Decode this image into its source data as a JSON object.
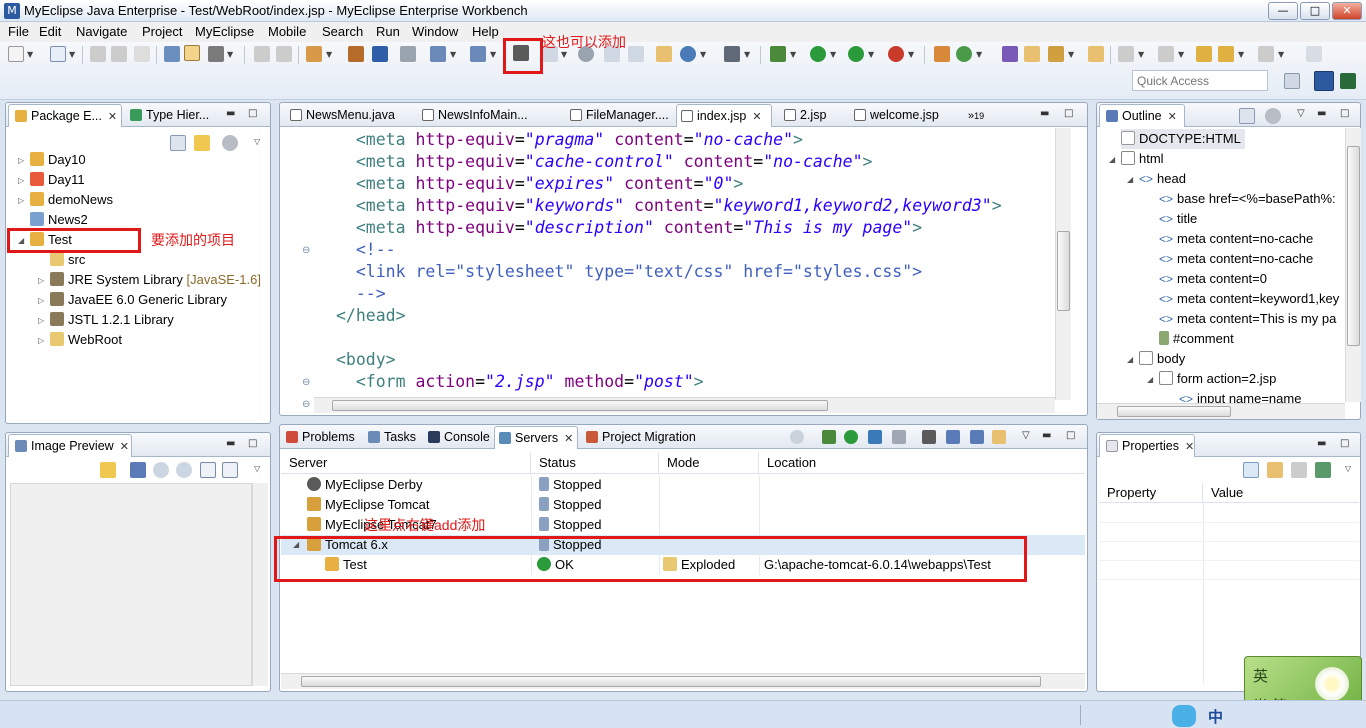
{
  "window": {
    "title": "MyEclipse Java Enterprise - Test/WebRoot/index.jsp - MyEclipse Enterprise Workbench"
  },
  "menu": [
    "File",
    "Edit",
    "Navigate",
    "Project",
    "MyEclipse",
    "Mobile",
    "Search",
    "Run",
    "Window",
    "Help"
  ],
  "toolbar": {
    "quick_access_placeholder": "Quick Access"
  },
  "annotations": {
    "toolbar_note": "这也可以添加",
    "project_note": "要添加的项目",
    "servers_note": "这里点右键add添加"
  },
  "package_explorer": {
    "tabs": [
      "Package E...",
      "Type Hier..."
    ],
    "items": [
      {
        "label": "Day10"
      },
      {
        "label": "Day11"
      },
      {
        "label": "demoNews"
      },
      {
        "label": "News2"
      },
      {
        "label": "Test"
      },
      {
        "label": "src"
      },
      {
        "label": "JRE System Library",
        "decoration": "[JavaSE-1.6]"
      },
      {
        "label": "JavaEE 6.0 Generic Library"
      },
      {
        "label": "JSTL 1.2.1 Library"
      },
      {
        "label": "WebRoot"
      }
    ]
  },
  "editor": {
    "tabs": [
      "NewsMenu.java",
      "NewsInfoMain...",
      "FileManager....",
      "index.jsp",
      "2.jsp",
      "welcome.jsp"
    ],
    "overflow": "19",
    "lines": [
      {
        "indent": "  ",
        "parts": [
          [
            "tg",
            "<meta "
          ],
          [
            "at",
            "http-equiv"
          ],
          [
            "tx",
            "="
          ],
          [
            "av",
            "\"pragma\""
          ],
          [
            "tx",
            " "
          ],
          [
            "at",
            "content"
          ],
          [
            "tx",
            "="
          ],
          [
            "av",
            "\"no-cache\""
          ],
          [
            "tg",
            ">"
          ]
        ]
      },
      {
        "indent": "  ",
        "parts": [
          [
            "tg",
            "<meta "
          ],
          [
            "at",
            "http-equiv"
          ],
          [
            "tx",
            "="
          ],
          [
            "av",
            "\"cache-control\""
          ],
          [
            "tx",
            " "
          ],
          [
            "at",
            "content"
          ],
          [
            "tx",
            "="
          ],
          [
            "av",
            "\"no-cache\""
          ],
          [
            "tg",
            ">"
          ]
        ]
      },
      {
        "indent": "  ",
        "parts": [
          [
            "tg",
            "<meta "
          ],
          [
            "at",
            "http-equiv"
          ],
          [
            "tx",
            "="
          ],
          [
            "av",
            "\"expires\""
          ],
          [
            "tx",
            " "
          ],
          [
            "at",
            "content"
          ],
          [
            "tx",
            "="
          ],
          [
            "av",
            "\"0\""
          ],
          [
            "tg",
            ">"
          ]
        ]
      },
      {
        "indent": "  ",
        "parts": [
          [
            "tg",
            "<meta "
          ],
          [
            "at",
            "http-equiv"
          ],
          [
            "tx",
            "="
          ],
          [
            "av",
            "\"keywords\""
          ],
          [
            "tx",
            " "
          ],
          [
            "at",
            "content"
          ],
          [
            "tx",
            "="
          ],
          [
            "av",
            "\"keyword1,keyword2,keyword3\""
          ],
          [
            "tg",
            ">"
          ]
        ]
      },
      {
        "indent": "  ",
        "parts": [
          [
            "tg",
            "<meta "
          ],
          [
            "at",
            "http-equiv"
          ],
          [
            "tx",
            "="
          ],
          [
            "av",
            "\"description\""
          ],
          [
            "tx",
            " "
          ],
          [
            "at",
            "content"
          ],
          [
            "tx",
            "="
          ],
          [
            "av",
            "\"This is my page\""
          ],
          [
            "tg",
            ">"
          ]
        ]
      },
      {
        "indent": "  ",
        "parts": [
          [
            "cm",
            "<!--"
          ]
        ]
      },
      {
        "indent": "  ",
        "parts": [
          [
            "cm",
            "<link rel=\"stylesheet\" type=\"text/css\" href=\"styles.css\">"
          ]
        ]
      },
      {
        "indent": "  ",
        "parts": [
          [
            "cm",
            "-->"
          ]
        ]
      },
      {
        "indent": "",
        "parts": [
          [
            "tg",
            "</head>"
          ]
        ]
      },
      {
        "indent": "",
        "parts": []
      },
      {
        "indent": "",
        "parts": [
          [
            "tg",
            "<body>"
          ]
        ]
      },
      {
        "indent": "  ",
        "parts": [
          [
            "tg",
            "<form "
          ],
          [
            "at",
            "action"
          ],
          [
            "tx",
            "="
          ],
          [
            "av",
            "\"2.jsp\""
          ],
          [
            "tx",
            " "
          ],
          [
            "at",
            "method"
          ],
          [
            "tx",
            "="
          ],
          [
            "av",
            "\"post\""
          ],
          [
            "tg",
            ">"
          ]
        ]
      }
    ]
  },
  "outline": {
    "tab": "Outline",
    "items": [
      "DOCTYPE:HTML",
      "html",
      "head",
      "base href=<%=basePath%:",
      "title",
      "meta content=no-cache",
      "meta content=no-cache",
      "meta content=0",
      "meta content=keyword1,key",
      "meta content=This is my pa",
      "#comment",
      "body",
      "form action=2.jsp",
      "input name=name"
    ]
  },
  "image_preview": {
    "tab": "Image Preview"
  },
  "bottom": {
    "tabs": [
      "Problems",
      "Tasks",
      "Console",
      "Servers",
      "Project Migration"
    ],
    "columns": [
      "Server",
      "Status",
      "Mode",
      "Location"
    ],
    "rows": [
      {
        "server": "MyEclipse Derby",
        "status": "Stopped",
        "mode": "",
        "location": ""
      },
      {
        "server": "MyEclipse Tomcat",
        "status": "Stopped",
        "mode": "",
        "location": ""
      },
      {
        "server": "MyEclipse Tomcat7",
        "status": "Stopped",
        "mode": "",
        "location": ""
      },
      {
        "server": "Tomcat  6.x",
        "status": "Stopped",
        "mode": "",
        "location": ""
      },
      {
        "server": "Test",
        "status": "OK",
        "mode": "Exploded",
        "location": "G:\\apache-tomcat-6.0.14\\webapps\\Test"
      }
    ]
  },
  "properties": {
    "tab": "Properties",
    "columns": [
      "Property",
      "Value"
    ]
  },
  "ime": {
    "top": "英",
    "bottom": "半 简",
    "tray": "中"
  },
  "colors": {
    "accent": "#2c5aa0",
    "annotation": "#e01818",
    "selection": "#dbe8f6"
  }
}
